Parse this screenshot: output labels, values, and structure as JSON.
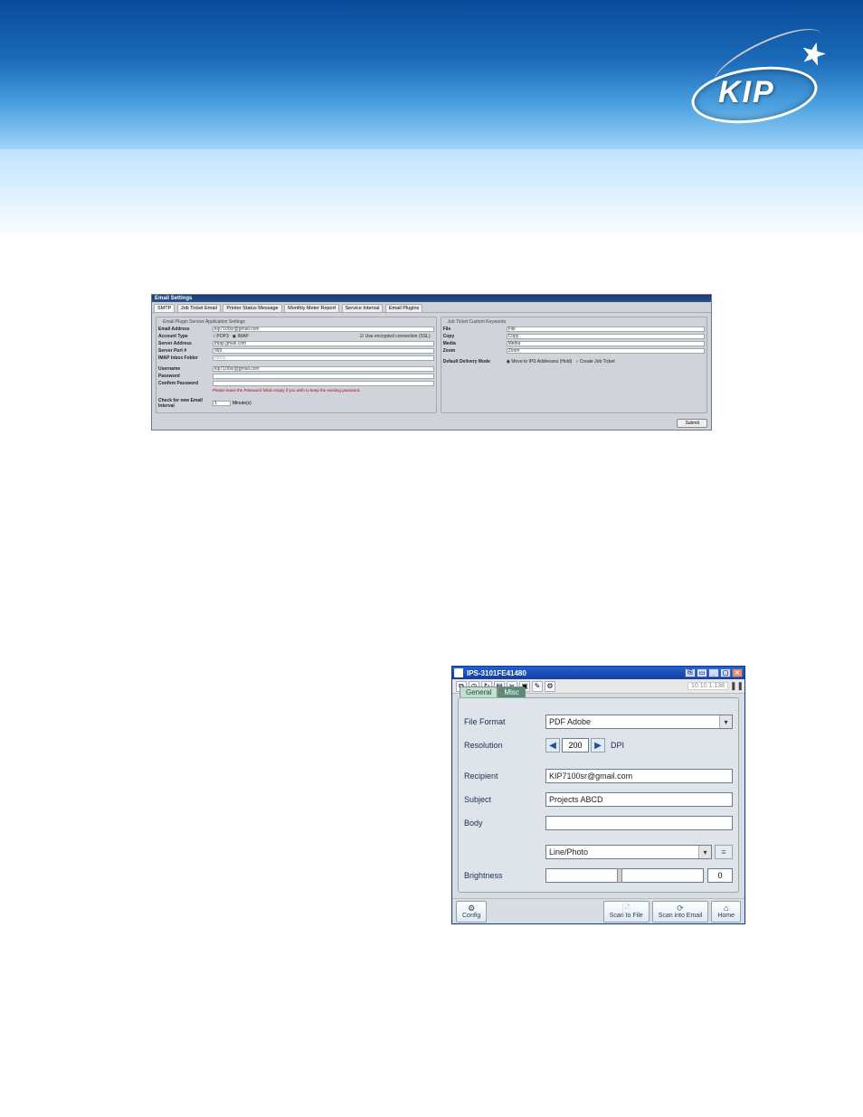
{
  "logo": {
    "text": "KIP"
  },
  "email_settings": {
    "window_title": "Email Settings",
    "tabs": [
      "SMTP",
      "Job Ticket Email",
      "Printer Status Message",
      "Monthly Meter Report",
      "Service Interval",
      "Email Plugins"
    ],
    "left_legend": "Email Plugin Service Application Settings",
    "right_legend": "Job Ticket Custom Keywords",
    "rows": {
      "email_address_label": "Email Address",
      "email_address_value": "kip7100sr@gmail.com",
      "account_type_label": "Account Type",
      "account_type_pop3": "POP3",
      "account_type_imap": "IMAP",
      "ssl_label": "Use encrypted connection (SSL)",
      "server_address_label": "Server Address",
      "server_address_value": "imap.gmail.com",
      "server_port_label": "Server Port #",
      "server_port_value": "993",
      "inbox_folder_label": "IMAP Inbox Folder",
      "inbox_folder_value": "Inbox",
      "username_label": "Username",
      "username_value": "kip7100sr@gmail.com",
      "password_label": "Password",
      "confirm_password_label": "Confirm Password",
      "password_note": "Please leave the Password fields empty if you wish to keep the existing password.",
      "check_interval_label": "Check for new Email Interval",
      "check_interval_value": "1",
      "check_interval_unit": "Minute(s)"
    },
    "right_rows": {
      "file_label": "File",
      "file_value": "File",
      "copy_label": "Copy",
      "copy_value": "Copy",
      "media_label": "Media",
      "media_value": "Media",
      "zoom_label": "Zoom",
      "zoom_value": "Zoom",
      "delivery_label": "Default Delivery Mode",
      "delivery_opt1": "Move to IPS Addresses (Hold)",
      "delivery_opt2": "Create Job Ticket"
    },
    "submit_label": "Submit"
  },
  "ips_window": {
    "title": "IPS-3101FE41480",
    "ip": "10.10.1.138",
    "tabs": {
      "general": "General",
      "misc": "Misc"
    },
    "fields": {
      "file_format_label": "File Format",
      "file_format_value": "PDF Adobe",
      "resolution_label": "Resolution",
      "resolution_value": "200",
      "resolution_unit": "DPI",
      "recipient_label": "Recipient",
      "recipient_value": "KIP7100sr@gmail.com",
      "subject_label": "Subject",
      "subject_value": "Projects ABCD",
      "body_label": "Body",
      "body_value": "",
      "mode_value": "Line/Photo",
      "brightness_label": "Brightness",
      "brightness_value": "0"
    },
    "footer": {
      "config": "Config",
      "scan_to_file": "Scan to File",
      "scan_into_email": "Scan into Email",
      "home": "Home"
    }
  }
}
